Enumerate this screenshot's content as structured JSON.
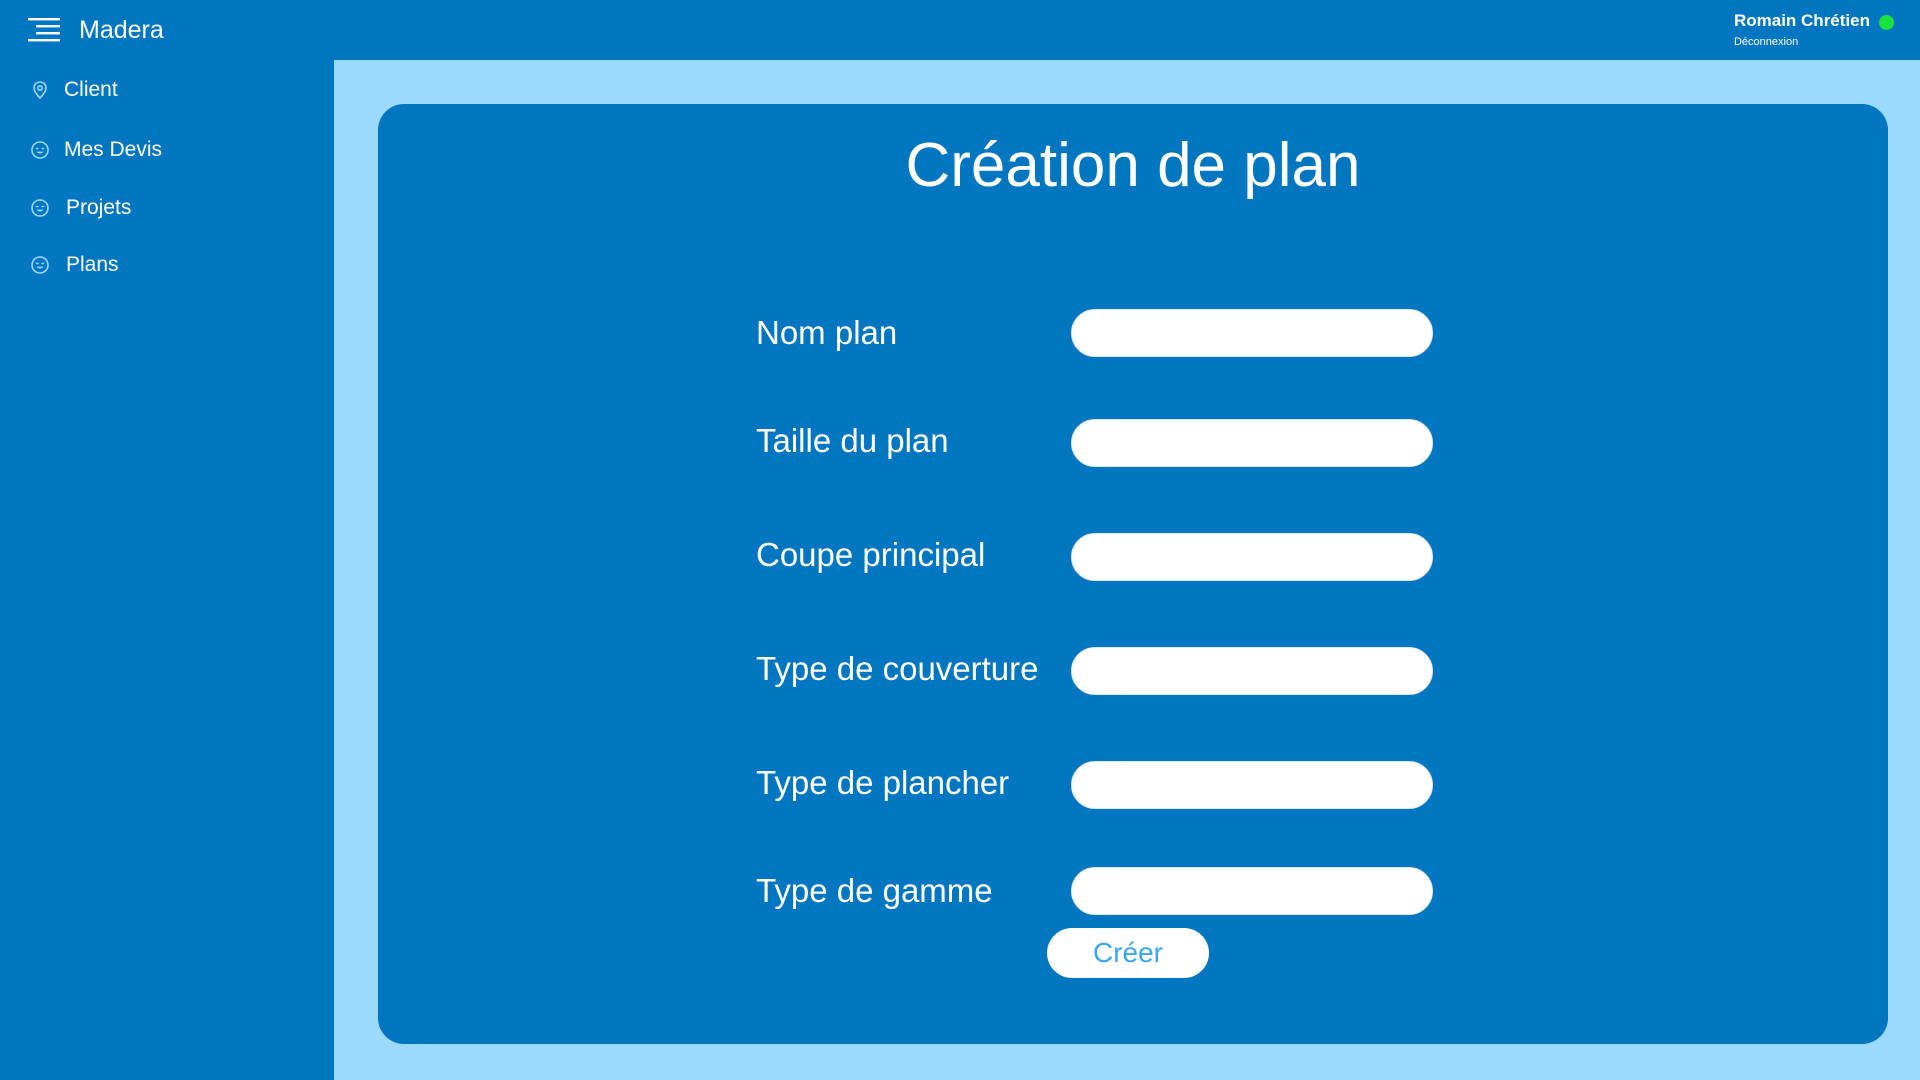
{
  "app": {
    "brand": "Madera"
  },
  "user": {
    "name": "Romain Chrétien",
    "logout_label": "Déconnexion",
    "status_color": "#19e33c"
  },
  "sidebar": {
    "items": [
      {
        "label": "Client",
        "icon": "location-pin-icon"
      },
      {
        "label": "Mes Devis",
        "icon": "smiley-icon"
      },
      {
        "label": "Projets",
        "icon": "smiley-icon"
      },
      {
        "label": "Plans",
        "icon": "smiley-icon"
      }
    ]
  },
  "form": {
    "title": "Création de plan",
    "fields": [
      {
        "label": "Nom plan",
        "value": ""
      },
      {
        "label": "Taille du plan",
        "value": ""
      },
      {
        "label": "Coupe principal",
        "value": ""
      },
      {
        "label": "Type de couverture",
        "value": ""
      },
      {
        "label": "Type de plancher",
        "value": ""
      },
      {
        "label": "Type de gamme",
        "value": ""
      }
    ],
    "submit_label": "Créer"
  },
  "colors": {
    "primary": "#0276c0",
    "background": "#9cd9fe",
    "accent": "#3aa6ef"
  }
}
